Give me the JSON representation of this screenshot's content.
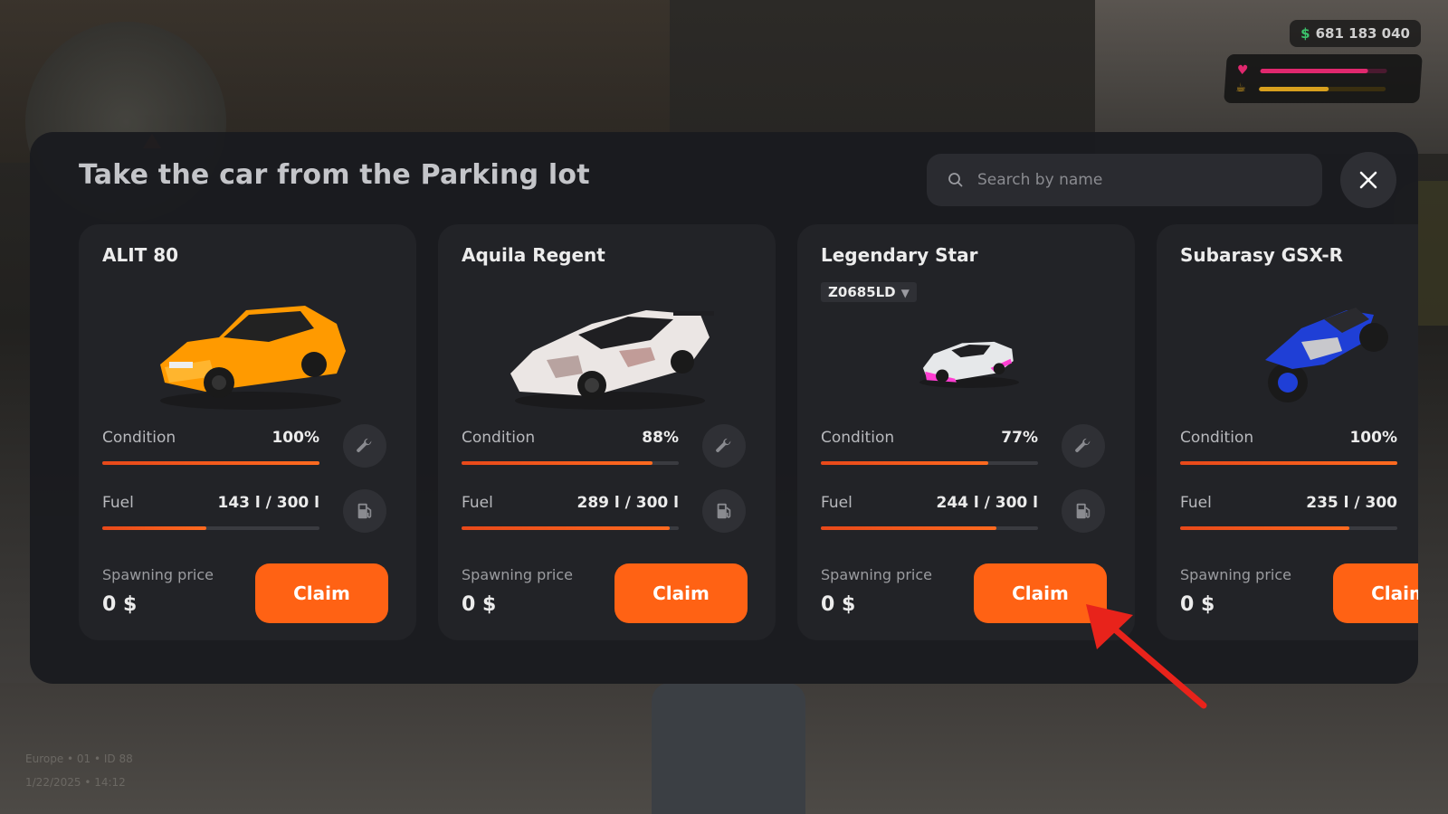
{
  "hud": {
    "money": "681 183 040",
    "money_symbol": "$",
    "health_level": 0.85,
    "hunger_level": 0.55
  },
  "info": {
    "server": "Europe • 01 • ID 88",
    "datetime": "1/22/2025 • 14:12"
  },
  "modal": {
    "title": "Take the car from the Parking lot",
    "search_placeholder": "Search by name",
    "close_icon": "close-icon"
  },
  "labels": {
    "condition": "Condition",
    "fuel": "Fuel",
    "spawning_price": "Spawning price",
    "claim": "Claim"
  },
  "cars": [
    {
      "name": "ALIT 80",
      "plate": "",
      "condition": "100%",
      "condition_level": 1.0,
      "fuel": "143 l / 300 l",
      "fuel_level": 0.48,
      "price": "0 $",
      "color": "#ff9a00",
      "type": "sedan"
    },
    {
      "name": "Aquila Regent",
      "plate": "",
      "condition": "88%",
      "condition_level": 0.88,
      "fuel": "289 l / 300 l",
      "fuel_level": 0.96,
      "price": "0 $",
      "color": "#e9e4e2",
      "type": "supercar"
    },
    {
      "name": "Legendary Star",
      "plate": "Z0685LD",
      "condition": "77%",
      "condition_level": 0.77,
      "fuel": "244 l / 300 l",
      "fuel_level": 0.81,
      "price": "0 $",
      "color": "#e6e8ea",
      "type": "hypercar"
    },
    {
      "name": "Subarasy GSX-R",
      "plate": "",
      "condition": "100%",
      "condition_level": 1.0,
      "fuel": "235 l / 300",
      "fuel_level": 0.78,
      "price": "0 $",
      "color": "#1f3fd6",
      "type": "motorcycle"
    }
  ],
  "colors": {
    "accent": "#ff6214",
    "card": "#222327",
    "modal": "#1a1b1f",
    "annotation_arrow": "#e8231b"
  }
}
